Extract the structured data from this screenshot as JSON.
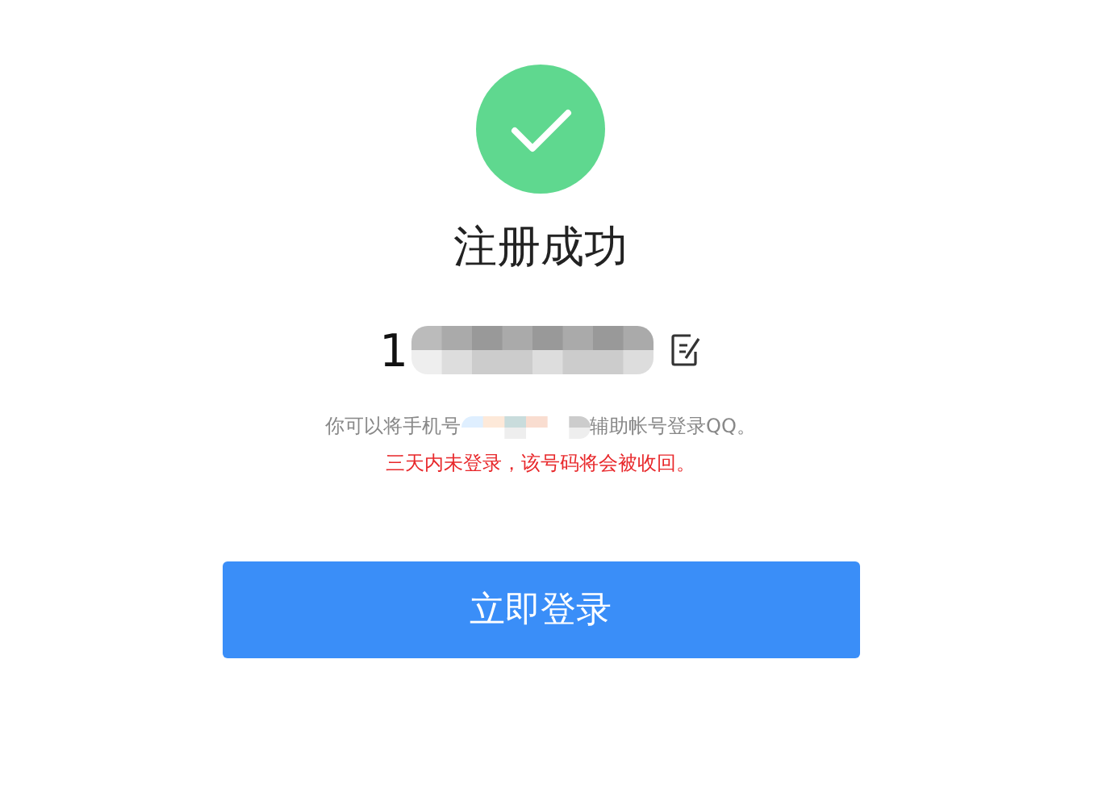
{
  "status": {
    "title": "注册成功"
  },
  "account": {
    "number_prefix": "1"
  },
  "notice": {
    "before": "你可以将手机号",
    "after": "辅助帐号登录QQ。"
  },
  "warning": "三天内未登录，该号码将会被收回。",
  "login_button": {
    "label": "立即登录"
  }
}
